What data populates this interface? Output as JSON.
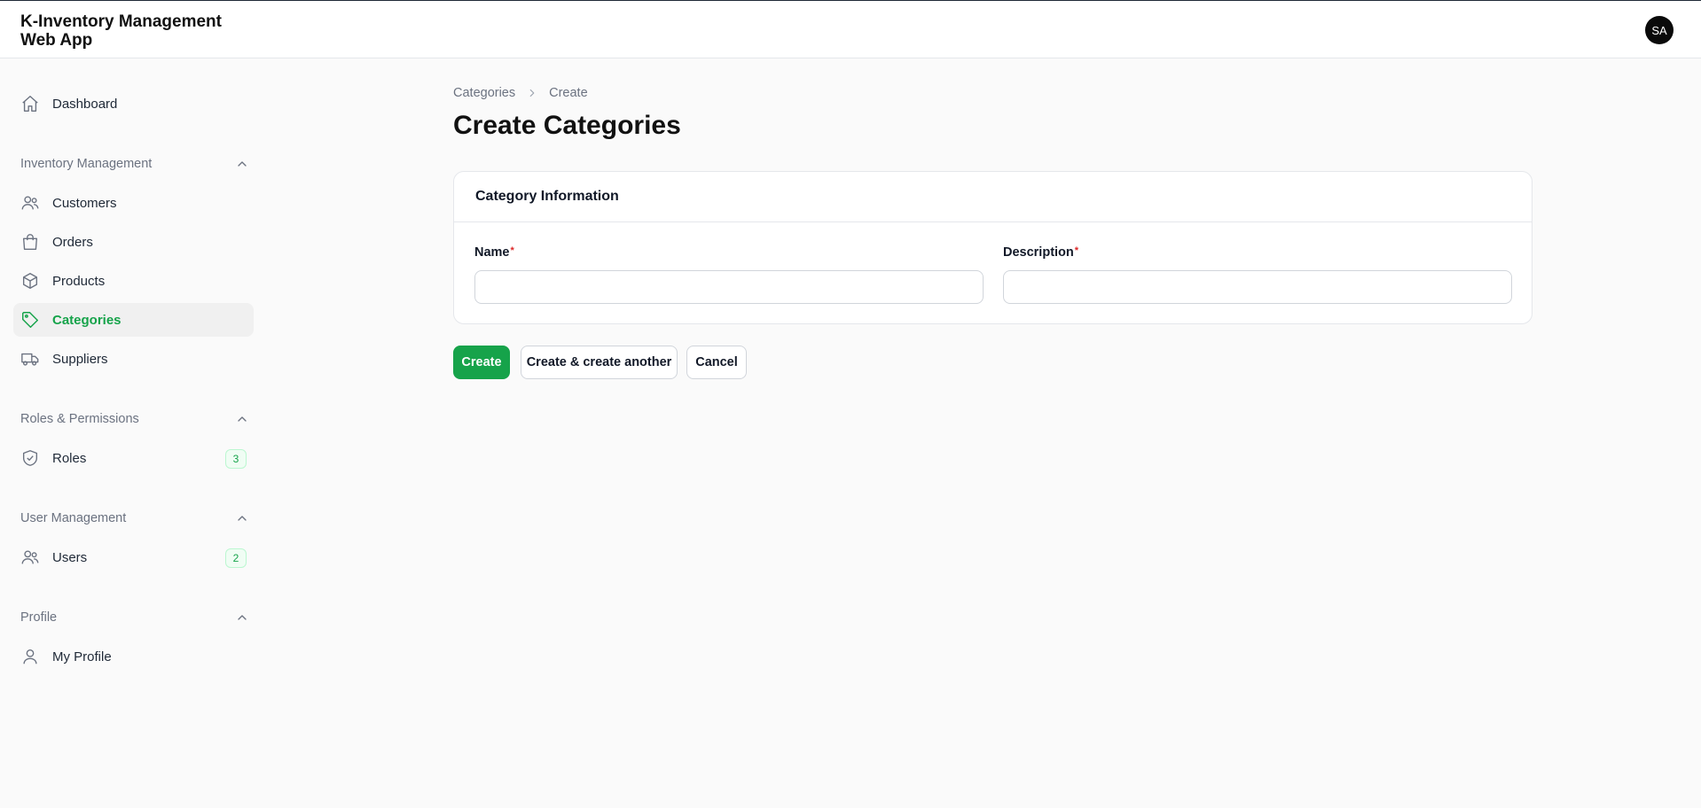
{
  "header": {
    "app_title": "K-Inventory Management Web App",
    "avatar_initials": "SA"
  },
  "sidebar": {
    "dashboard": {
      "label": "Dashboard",
      "icon": "home-icon"
    },
    "groups": [
      {
        "label": "Inventory Management",
        "items": [
          {
            "label": "Customers",
            "icon": "users-icon"
          },
          {
            "label": "Orders",
            "icon": "shopping-bag-icon"
          },
          {
            "label": "Products",
            "icon": "cube-icon"
          },
          {
            "label": "Categories",
            "icon": "tag-icon",
            "active": true
          },
          {
            "label": "Suppliers",
            "icon": "truck-icon"
          }
        ]
      },
      {
        "label": "Roles & Permissions",
        "items": [
          {
            "label": "Roles",
            "icon": "shield-check-icon",
            "badge": "3"
          }
        ]
      },
      {
        "label": "User Management",
        "items": [
          {
            "label": "Users",
            "icon": "users-icon",
            "badge": "2"
          }
        ]
      },
      {
        "label": "Profile",
        "items": [
          {
            "label": "My Profile",
            "icon": "user-icon"
          }
        ]
      }
    ]
  },
  "breadcrumb": {
    "parent": "Categories",
    "current": "Create"
  },
  "page": {
    "title": "Create Categories"
  },
  "form": {
    "section_title": "Category Information",
    "name": {
      "label": "Name",
      "required_mark": "*",
      "value": "",
      "placeholder": ""
    },
    "description": {
      "label": "Description",
      "required_mark": "*",
      "value": "",
      "placeholder": ""
    }
  },
  "actions": {
    "create": "Create",
    "create_another": "Create & create another",
    "cancel": "Cancel"
  },
  "colors": {
    "accent": "#16a34a",
    "required": "#dc2626",
    "background": "#fafafa"
  }
}
